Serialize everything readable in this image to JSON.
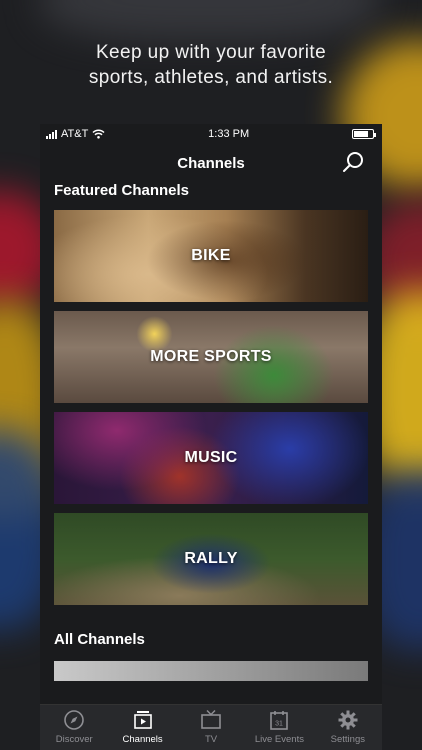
{
  "tagline": {
    "line1": "Keep up with your favorite",
    "line2": "sports, athletes, and artists."
  },
  "status_bar": {
    "carrier": "AT&T",
    "time": "1:33 PM"
  },
  "nav": {
    "title": "Channels",
    "search_icon": "search-icon"
  },
  "sections": {
    "featured_title": "Featured Channels",
    "all_title": "All Channels"
  },
  "featured_channels": [
    {
      "label": "BIKE"
    },
    {
      "label": "MORE SPORTS"
    },
    {
      "label": "MUSIC"
    },
    {
      "label": "RALLY"
    }
  ],
  "tabs": [
    {
      "label": "Discover",
      "icon": "compass-icon",
      "active": false
    },
    {
      "label": "Channels",
      "icon": "channels-icon",
      "active": true
    },
    {
      "label": "TV",
      "icon": "tv-icon",
      "active": false
    },
    {
      "label": "Live Events",
      "icon": "calendar-icon",
      "active": false,
      "icon_text": "31"
    },
    {
      "label": "Settings",
      "icon": "gear-icon",
      "active": false
    }
  ],
  "colors": {
    "background": "#1e1f22",
    "tab_inactive": "#8e8e93",
    "tab_active": "#ffffff"
  }
}
